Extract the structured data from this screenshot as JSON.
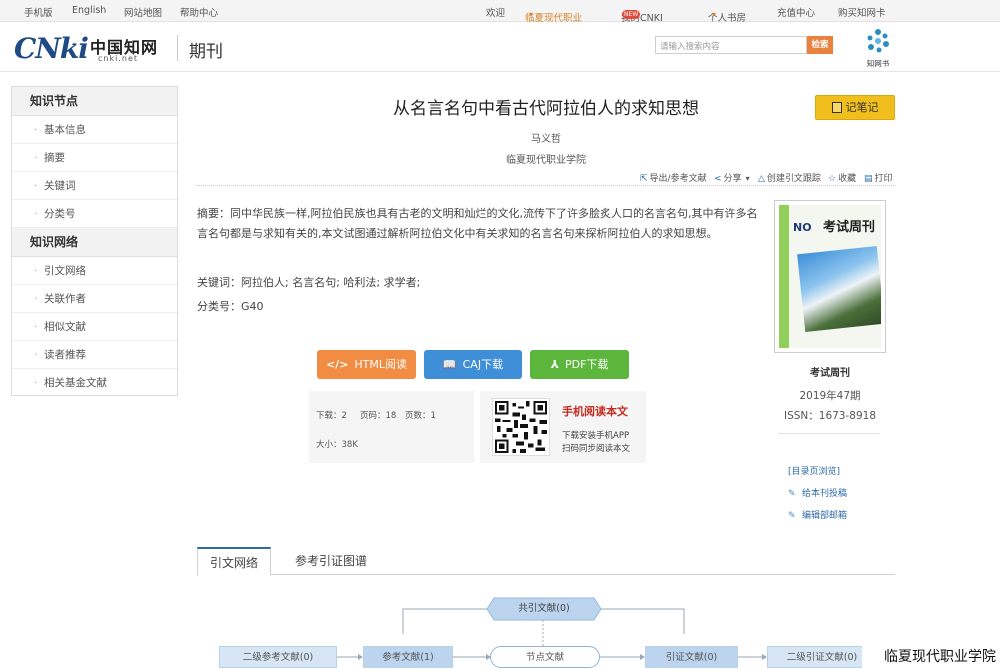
{
  "topbar": {
    "mobile": "手机版",
    "english": "English",
    "sitemap": "网站地图",
    "help": "帮助中心",
    "welcome": "欢迎",
    "org": "临夏现代职业",
    "mycnki": "我的CNKI",
    "new_badge": "NEW",
    "personal": "个人书房",
    "recharge": "充值中心",
    "buy": "购买知网卡"
  },
  "header": {
    "logo_latin": "CNki",
    "logo_cn": "中国知网",
    "logo_url": "cnki.net",
    "section": "期刊",
    "search_placeholder": "请输入搜索内容",
    "search_button": "检索",
    "zhiwang_label": "知网书"
  },
  "sidebar": {
    "group1_title": "知识节点",
    "group1_items": [
      "基本信息",
      "摘要",
      "关键词",
      "分类号"
    ],
    "group2_title": "知识网络",
    "group2_items": [
      "引文网络",
      "关联作者",
      "相似文献",
      "读者推荐",
      "相关基金文献"
    ]
  },
  "article": {
    "title": "从名言名句中看古代阿拉伯人的求知思想",
    "note_button": "记笔记",
    "author": "马义哲",
    "org": "临夏现代职业学院",
    "abstract": "摘要：同中华民族一样,阿拉伯民族也具有古老的文明和灿烂的文化,流传下了许多脍炙人口的名言名句,其中有许多名言名句都是与求知有关的,本文试图通过解析阿拉伯文化中有关求知的名言名句来探析阿拉伯人的求知思想。",
    "keywords": "关键词：阿拉伯人; 名言名句; 哈利法; 求学者;",
    "class_no": "分类号：G40"
  },
  "actions": {
    "export": "导出/参考文献",
    "share": "分享",
    "track": "创建引文跟踪",
    "favorite": "收藏",
    "print": "打印"
  },
  "downloads": {
    "html": "HTML阅读",
    "caj": "CAJ下载",
    "pdf": "PDF下载"
  },
  "stats": {
    "downloads": "下载：2",
    "pages": "页码：18",
    "page_count": "页数：1",
    "size": "大小：38K"
  },
  "mobile": {
    "title": "手机阅读本文",
    "line1": "下载安装手机APP",
    "line2": "扫码同步阅读本文"
  },
  "journal": {
    "cover_no": "NO",
    "cover_title": "考试周刊",
    "name": "考试周刊",
    "issue": "2019年47期",
    "issn": "ISSN：1673-8918",
    "link_toc": "[目录页浏览]",
    "link_submit": "给本刊投稿",
    "link_editor": "编辑部邮箱"
  },
  "tabs": [
    "引文网络",
    "参考引证图谱"
  ],
  "diagram": {
    "co_cited": "共引文献(0)",
    "second_ref": "二级参考文献(0)",
    "ref": "参考文献(1)",
    "node": "节点文献",
    "cited": "引证文献(0)",
    "second_cited": "二级引证文献(0)"
  },
  "overlay_label": "临夏现代职业学院",
  "colors": {
    "accent_orange": "#f18c42",
    "accent_blue": "#3f8ed8",
    "accent_green": "#5bb63b",
    "note_yellow": "#f0bf1d"
  }
}
